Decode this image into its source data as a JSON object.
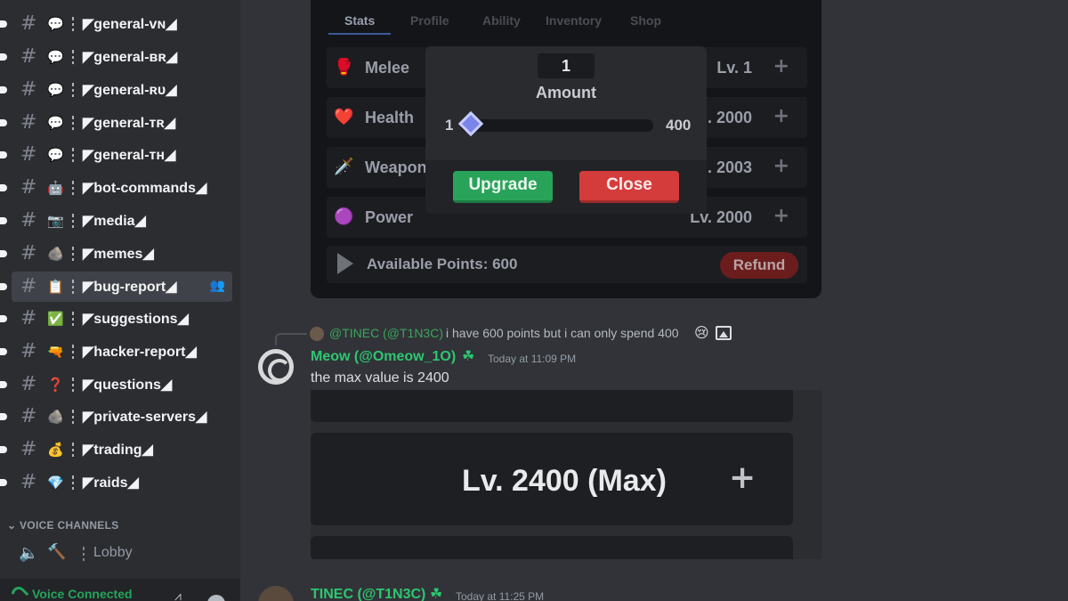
{
  "sidebar": {
    "channels": [
      {
        "name": "◤general-ᴠɴ◢",
        "emoji": "💬",
        "emoji_name": "speech-bubble-icon"
      },
      {
        "name": "◤general-ʙʀ◢",
        "emoji": "💬",
        "emoji_name": "speech-bubble-icon"
      },
      {
        "name": "◤general-ʀᴜ◢",
        "emoji": "💬",
        "emoji_name": "speech-bubble-icon"
      },
      {
        "name": "◤general-ᴛʀ◢",
        "emoji": "💬",
        "emoji_name": "speech-bubble-icon"
      },
      {
        "name": "◤general-ᴛʜ◢",
        "emoji": "💬",
        "emoji_name": "speech-bubble-icon"
      },
      {
        "name": "◤bot-commands◢",
        "emoji": "🤖",
        "emoji_name": "robot-icon"
      },
      {
        "name": "◤media◢",
        "emoji": "📷",
        "emoji_name": "camera-icon"
      },
      {
        "name": "◤memes◢",
        "emoji": "🪨",
        "emoji_name": "rock-icon"
      },
      {
        "name": "◤bug-report◢",
        "emoji": "📋",
        "emoji_name": "clipboard-icon",
        "active": true
      },
      {
        "name": "◤suggestions◢",
        "emoji": "✅",
        "emoji_name": "check-mark-icon"
      },
      {
        "name": "◤hacker-report◢",
        "emoji": "🔫",
        "emoji_name": "gun-icon"
      },
      {
        "name": "◤questions◢",
        "emoji": "❓",
        "emoji_name": "question-mark-icon"
      },
      {
        "name": "◤private-servers◢",
        "emoji": "🪨",
        "emoji_name": "rock-icon"
      },
      {
        "name": "◤trading◢",
        "emoji": "💰",
        "emoji_name": "money-bag-icon"
      },
      {
        "name": "◤raids◢",
        "emoji": "💎",
        "emoji_name": "gem-icon"
      }
    ],
    "voice_header": "VOICE CHANNELS",
    "voice_channel": "Lobby",
    "voice_status": "Voice Connected"
  },
  "game": {
    "tabs": [
      "Stats",
      "Profile",
      "Ability",
      "Inventory",
      "Shop"
    ],
    "active_tab": "Stats",
    "stats": [
      {
        "name": "Melee",
        "level": "Lv. 1",
        "icon": "🥊",
        "icon_name": "melee-icon"
      },
      {
        "name": "Health",
        "level": ". 2000",
        "icon": "❤️",
        "icon_name": "heart-icon"
      },
      {
        "name": "Weapon",
        "level": ". 2003",
        "icon": "🗡️",
        "icon_name": "sword-icon"
      },
      {
        "name": "Power",
        "level": "Lv. 2000",
        "icon": "🟣",
        "icon_name": "power-fruit-icon"
      }
    ],
    "plus": "+",
    "available_points": "Available Points: 600",
    "refund_label": "Refund",
    "modal": {
      "amount_value": "1",
      "amount_label": "Amount",
      "slider_min": "1",
      "slider_max": "400",
      "slider_value_fraction": 0,
      "upgrade_label": "Upgrade",
      "close_label": "Close"
    }
  },
  "message": {
    "reply_author": "@TINEC (@T1N3C)",
    "reply_text": "i have 600 points but i can only spend 400",
    "reply_emoji": "😢",
    "author": "Meow (@Omeow_1O)",
    "timestamp": "Today at 11:09 PM",
    "text": "the max value is 2400",
    "embed_level": "Lv. 2400 (Max)",
    "embed_plus": "+"
  },
  "next_message": {
    "author": "TINEC (@T1N3C)",
    "timestamp": "Today at 11:25 PM"
  },
  "colors": {
    "bg": "#313338",
    "sidebar": "#2b2d31",
    "accent_green": "#2dc770",
    "upgrade_green": "#2aa35a",
    "close_red": "#d43c3c"
  }
}
